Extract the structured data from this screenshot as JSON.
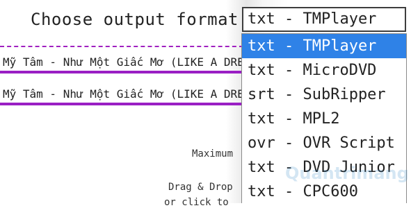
{
  "format": {
    "label": "Choose output format",
    "selected_value": "txt - TMPlayer",
    "options": [
      "txt - TMPlayer",
      "txt - MicroDVD",
      "srt - SubRipper",
      "txt - MPL2",
      "ovr - OVR Script",
      "txt - DVD Junior",
      "txt - CPC600"
    ]
  },
  "songs": [
    "Mỹ Tâm - Như Một Giấc Mơ (LIKE A DREAM)",
    "Mỹ Tâm - Như Một Giấc Mơ (LIKE A DREAM)"
  ],
  "upload": {
    "max_label": "Maximum",
    "drag_label": "Drag & Drop",
    "click_label": "or click to"
  },
  "watermark": "Quantrimang"
}
